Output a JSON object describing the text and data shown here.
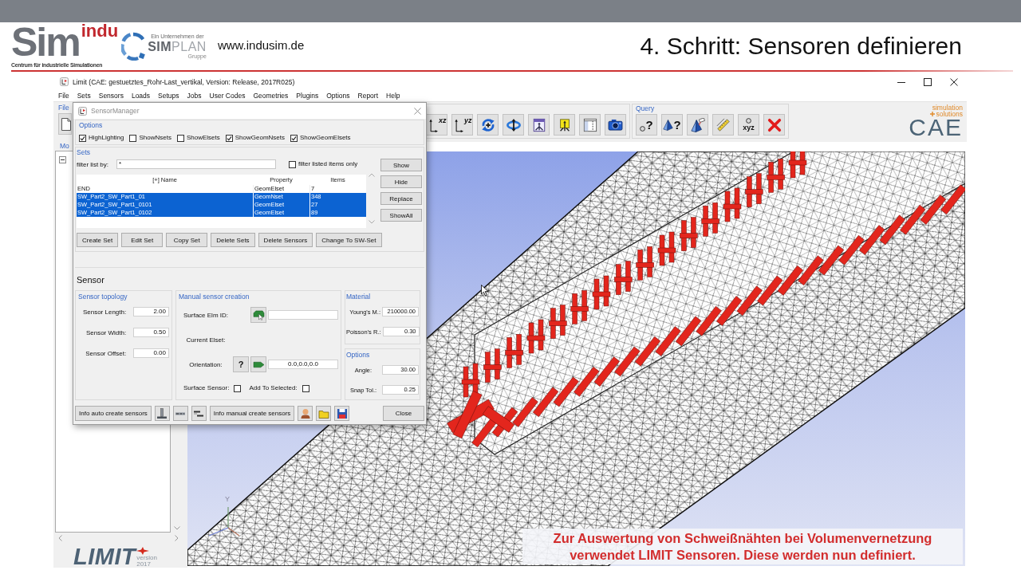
{
  "slide": {
    "logo": {
      "wordmark": "Sim",
      "accent": "indu",
      "tagline": "Centrum für industrielle Simulationen"
    },
    "partner_logo": {
      "caption": "Ein Unternehmen der",
      "name": "**SIM**PLAN",
      "suffix": "Gruppe"
    },
    "url": "www.indusim.de",
    "title": "4. Schritt: Sensoren definieren",
    "caption": "Zur Auswertung von Schweißnähten bei Volumenvernetzung verwendet LIMIT Sensoren. Diese werden nun definiert."
  },
  "window": {
    "title": "Limit (CAE: gestuetztes_Rohr-Last_vertikal, Version: Release, 2017R025)"
  },
  "menu": [
    "File",
    "Sets",
    "Sensors",
    "Loads",
    "Setups",
    "Jobs",
    "User Codes",
    "Geometries",
    "Plugins",
    "Options",
    "Report",
    "Help"
  ],
  "toolbar": {
    "file_group": {
      "label": "File",
      "buttons": [
        {
          "kind": "page"
        }
      ]
    },
    "view_group": {
      "buttons": [
        {
          "kind": "axes",
          "label": "xz"
        },
        {
          "kind": "axes",
          "label": "yz"
        },
        {
          "kind": "rotate"
        },
        {
          "kind": "orbit"
        },
        {
          "kind": "fit"
        },
        {
          "kind": "frame"
        },
        {
          "kind": "panel"
        },
        {
          "kind": "camera"
        }
      ]
    },
    "query_group": {
      "label": "Query",
      "buttons": [
        {
          "kind": "circlequery",
          "label": "?"
        },
        {
          "kind": "pyramidquery",
          "label": "?"
        },
        {
          "kind": "pyramidbrush"
        },
        {
          "kind": "ruler"
        },
        {
          "kind": "coords",
          "label": "xyz"
        },
        {
          "kind": "delete"
        }
      ]
    },
    "brand_logo": {
      "line_1": "simulation",
      "line_2": "solutions",
      "name": "CAE"
    }
  },
  "left_panel": {
    "label": "Mo",
    "app_logo": {
      "name": "LIMIT",
      "version_label": "version",
      "version_year": "2017"
    }
  },
  "viewport": {
    "axis_label": "Y"
  },
  "sensor_manager": {
    "title": "SensorManager",
    "options": {
      "label": "Options",
      "checkboxes": [
        {
          "label": "HighLighting",
          "checked": true
        },
        {
          "label": "ShowNsets",
          "checked": false
        },
        {
          "label": "ShowElsets",
          "checked": false
        },
        {
          "label": "ShowGeomNsets",
          "checked": true
        },
        {
          "label": "ShowGeomElsets",
          "checked": true
        }
      ]
    },
    "sets": {
      "label": "Sets",
      "filter_label": "filter list by:",
      "filter_value": "*",
      "filter_only": {
        "label": "filter listed items only",
        "checked": false
      },
      "table": {
        "columns": [
          "[+] Name",
          "Property",
          "Items"
        ],
        "rows": [
          {
            "cells": [
              "END",
              "GeomElset",
              "7"
            ],
            "selected": false
          },
          {
            "cells": [
              "SW_Part2_SW_Part1_01",
              "GeomNset",
              "348"
            ],
            "selected": true
          },
          {
            "cells": [
              "SW_Part2_SW_Part1_0101",
              "GeomElset",
              "27"
            ],
            "selected": true
          },
          {
            "cells": [
              "SW_Part2_SW_Part1_0102",
              "GeomElset",
              "89"
            ],
            "selected": true
          }
        ]
      },
      "side_buttons": [
        "Show",
        "Hide",
        "Replace",
        "ShowAll"
      ],
      "buttons": [
        "Create Set",
        "Edit Set",
        "Copy Set",
        "Delete Sets",
        "Delete Sensors",
        "Change To SW-Set"
      ]
    },
    "sensor": {
      "heading": "Sensor",
      "topology": {
        "label": "Sensor topology",
        "fields": [
          {
            "label": "Sensor Length:",
            "value": "2.00"
          },
          {
            "label": "Sensor Width:",
            "value": "0.50"
          },
          {
            "label": "Sensor Offset:",
            "value": "0.00"
          }
        ]
      },
      "manual": {
        "label": "Manual sensor creation",
        "surface_elm_label": "Surface Elm ID:",
        "current_elset_label": "Current Elset:",
        "orientation": {
          "label": "Orientation:",
          "help_button": "?",
          "value": "0.0,0.0,0.0"
        },
        "checks": [
          {
            "label": "Surface Sensor:",
            "checked": false
          },
          {
            "label": "Add To Selected:",
            "checked": false
          }
        ]
      },
      "material": {
        "label": "Material",
        "fields": [
          {
            "label": "Young's M.:",
            "value": "210000.00"
          },
          {
            "label": "Poisson's R.:",
            "value": "0.30"
          }
        ]
      },
      "options": {
        "label": "Options",
        "fields": [
          {
            "label": "Angle:",
            "value": "30.00"
          },
          {
            "label": "Snap Tol.:",
            "value": "0.25"
          }
        ]
      }
    },
    "footer": [
      {
        "kind": "text",
        "label": "Info auto create sensors"
      },
      {
        "kind": "perpendicular"
      },
      {
        "kind": "bar"
      },
      {
        "kind": "steps"
      },
      {
        "kind": "text",
        "label": "Info manual create sensors"
      },
      {
        "kind": "user"
      },
      {
        "kind": "folder"
      },
      {
        "kind": "save"
      }
    ],
    "close_button": "Close"
  }
}
